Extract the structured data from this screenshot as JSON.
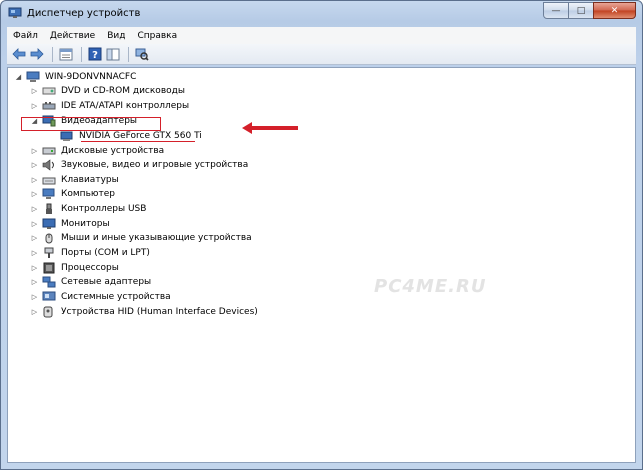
{
  "window": {
    "title": "Диспетчер устройств"
  },
  "caption_buttons": {
    "minimize": "—",
    "maximize": "□",
    "close": "✕"
  },
  "menu": {
    "items": [
      "Файл",
      "Действие",
      "Вид",
      "Справка"
    ]
  },
  "toolbar": {
    "icons": [
      "back-arrow-icon",
      "forward-arrow-icon",
      "properties-grid-icon",
      "help-icon",
      "panel-icon",
      "scan-hardware-icon"
    ]
  },
  "tree": {
    "root": "WIN-9DONVNNACFC",
    "items": [
      {
        "label": "DVD и CD-ROM дисководы",
        "icon": "dvd-drive-icon",
        "expanded": false
      },
      {
        "label": "IDE ATA/ATAPI контроллеры",
        "icon": "ide-controller-icon",
        "expanded": false
      },
      {
        "label": "Видеоадаптеры",
        "icon": "display-adapter-icon",
        "expanded": true,
        "children": [
          {
            "label": "NVIDIA GeForce GTX 560 Ti",
            "icon": "gpu-icon"
          }
        ]
      },
      {
        "label": "Дисковые устройства",
        "icon": "disk-drive-icon",
        "expanded": false
      },
      {
        "label": "Звуковые, видео и игровые устройства",
        "icon": "sound-icon",
        "expanded": false
      },
      {
        "label": "Клавиатуры",
        "icon": "keyboard-icon",
        "expanded": false
      },
      {
        "label": "Компьютер",
        "icon": "computer-icon",
        "expanded": false
      },
      {
        "label": "Контроллеры USB",
        "icon": "usb-icon",
        "expanded": false
      },
      {
        "label": "Мониторы",
        "icon": "monitor-icon",
        "expanded": false
      },
      {
        "label": "Мыши и иные указывающие устройства",
        "icon": "mouse-icon",
        "expanded": false
      },
      {
        "label": "Порты (COM и LPT)",
        "icon": "port-icon",
        "expanded": false
      },
      {
        "label": "Процессоры",
        "icon": "processor-icon",
        "expanded": false
      },
      {
        "label": "Сетевые адаптеры",
        "icon": "network-adapter-icon",
        "expanded": false
      },
      {
        "label": "Системные устройства",
        "icon": "system-device-icon",
        "expanded": false
      },
      {
        "label": "Устройства HID (Human Interface Devices)",
        "icon": "hid-icon",
        "expanded": false
      }
    ]
  },
  "expander_glyphs": {
    "collapsed": "▷",
    "expanded": "◢"
  },
  "watermark": "PC4ME.RU",
  "colors": {
    "annotation_red": "#d4202a",
    "title_gradient": "#b6cbe6"
  }
}
